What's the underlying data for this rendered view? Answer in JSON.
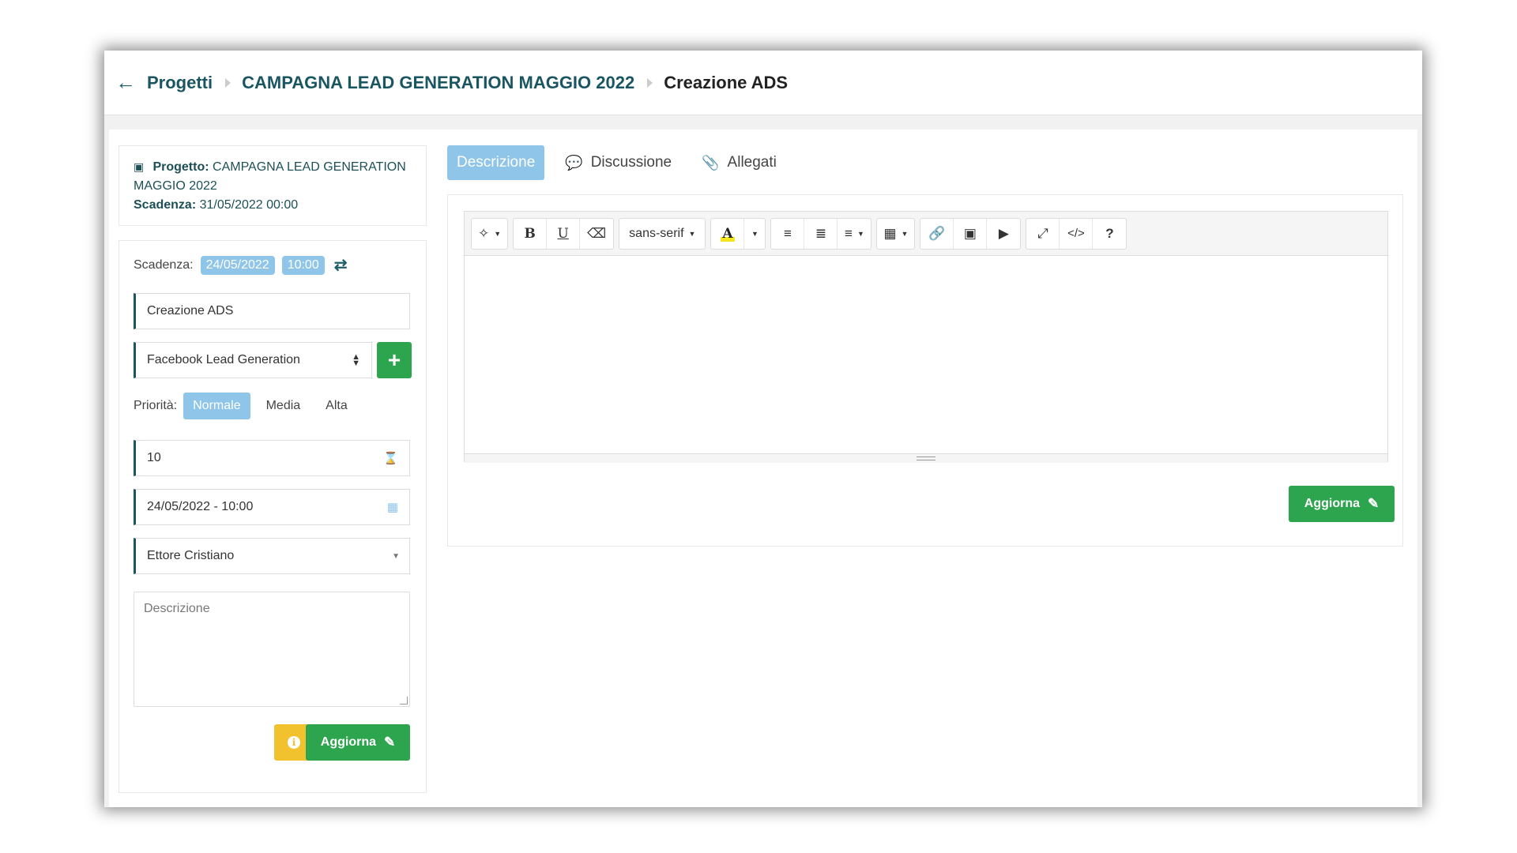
{
  "breadcrumb": {
    "items": [
      "Progetti",
      "CAMPAGNA LEAD GENERATION MAGGIO 2022",
      "Creazione ADS"
    ]
  },
  "info": {
    "project_label": "Progetto:",
    "project_name": "CAMPAGNA LEAD GENERATION MAGGIO 2022",
    "deadline_label": "Scadenza:",
    "deadline_value": "31/05/2022 00:00"
  },
  "form": {
    "deadline_label": "Scadenza:",
    "deadline_date": "24/05/2022",
    "deadline_time": "10:00",
    "title_value": "Creazione ADS",
    "category_value": "Facebook Lead Generation",
    "priority_label": "Priorità:",
    "priority_options": [
      "Normale",
      "Media",
      "Alta"
    ],
    "priority_selected": "Normale",
    "hours_value": "10",
    "datetime_value": "24/05/2022 - 10:00",
    "assignee_value": "Ettore Cristiano",
    "description_placeholder": "Descrizione",
    "update_label": "Aggiorna"
  },
  "tabs": [
    "Descrizione",
    "Discussione",
    "Allegati"
  ],
  "editor": {
    "font_name": "sans-serif",
    "update_label": "Aggiorna"
  },
  "colors": {
    "primary": "#1a5661",
    "accent": "#8ec5e9",
    "success": "#2da44e",
    "warning": "#f2c12e"
  }
}
